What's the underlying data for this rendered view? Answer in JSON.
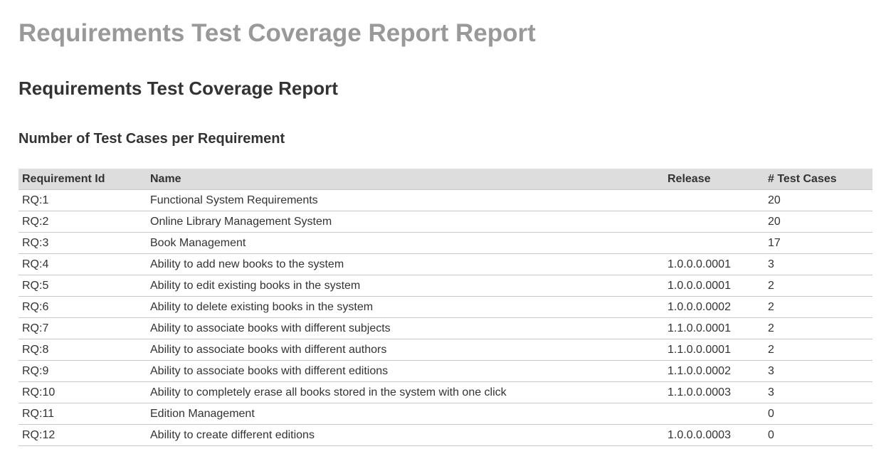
{
  "report": {
    "title": "Requirements Test Coverage Report Report",
    "section_title": "Requirements Test Coverage Report",
    "sub_title": "Number of Test Cases per Requirement"
  },
  "table": {
    "headers": {
      "id": "Requirement Id",
      "name": "Name",
      "release": "Release",
      "test_cases": "# Test Cases"
    },
    "rows": [
      {
        "id": "RQ:1",
        "name": "Functional System Requirements",
        "release": "",
        "test_cases": "20"
      },
      {
        "id": "RQ:2",
        "name": "Online Library Management System",
        "release": "",
        "test_cases": "20"
      },
      {
        "id": "RQ:3",
        "name": "Book Management",
        "release": "",
        "test_cases": "17"
      },
      {
        "id": "RQ:4",
        "name": "Ability to add new books to the system",
        "release": "1.0.0.0.0001",
        "test_cases": "3"
      },
      {
        "id": "RQ:5",
        "name": "Ability to edit existing books in the system",
        "release": "1.0.0.0.0001",
        "test_cases": "2"
      },
      {
        "id": "RQ:6",
        "name": "Ability to delete existing books in the system",
        "release": "1.0.0.0.0002",
        "test_cases": "2"
      },
      {
        "id": "RQ:7",
        "name": "Ability to associate books with different subjects",
        "release": "1.1.0.0.0001",
        "test_cases": "2"
      },
      {
        "id": "RQ:8",
        "name": "Ability to associate books with different authors",
        "release": "1.1.0.0.0001",
        "test_cases": "2"
      },
      {
        "id": "RQ:9",
        "name": "Ability to associate books with different editions",
        "release": "1.1.0.0.0002",
        "test_cases": "3"
      },
      {
        "id": "RQ:10",
        "name": "Ability to completely erase all books stored in the system with one click",
        "release": "1.1.0.0.0003",
        "test_cases": "3"
      },
      {
        "id": "RQ:11",
        "name": "Edition Management",
        "release": "",
        "test_cases": "0"
      },
      {
        "id": "RQ:12",
        "name": "Ability to create different editions",
        "release": "1.0.0.0.0003",
        "test_cases": "0"
      }
    ]
  }
}
